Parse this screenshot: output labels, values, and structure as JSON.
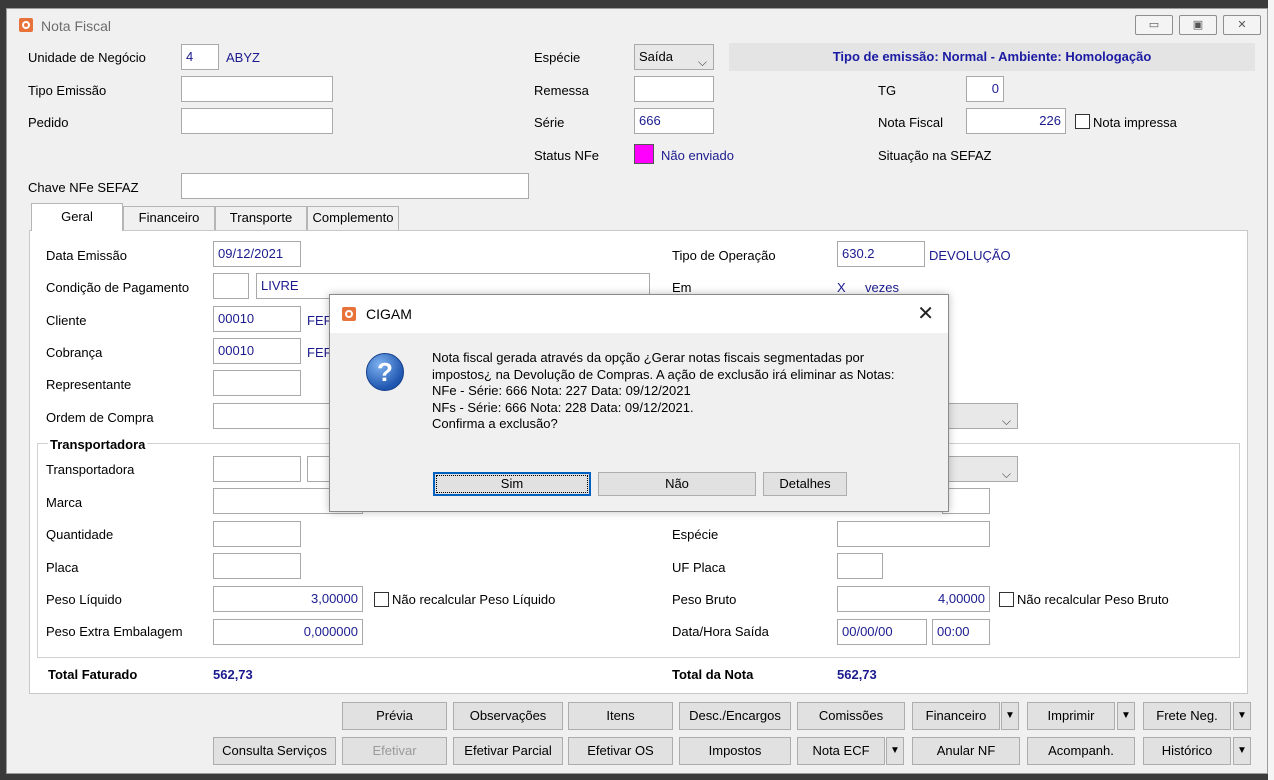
{
  "window": {
    "title": "Nota Fiscal",
    "btn_min": "▭",
    "btn_max": "▣",
    "btn_close": "✕"
  },
  "header": {
    "unidade_label": "Unidade de Negócio",
    "unidade_code": "4",
    "unidade_name": "ABYZ",
    "tipo_emissao_label": "Tipo Emissão",
    "tipo_emissao_value": "",
    "pedido_label": "Pedido",
    "pedido_value": "",
    "especie_label": "Espécie",
    "especie_value": "Saída",
    "remessa_label": "Remessa",
    "remessa_value": "",
    "serie_label": "Série",
    "serie_value": "666",
    "status_nfe_label": "Status NFe",
    "status_nfe_value": "Não enviado",
    "banner": "Tipo de emissão: Normal - Ambiente: Homologação",
    "tg_label": "TG",
    "tg_value": "0",
    "nota_fiscal_label": "Nota Fiscal",
    "nota_fiscal_value": "226",
    "nota_impressa_label": "Nota impressa",
    "situacao_label": "Situação na SEFAZ",
    "chave_label": "Chave NFe SEFAZ",
    "chave_value": ""
  },
  "tabs": [
    "Geral",
    "Financeiro",
    "Transporte",
    "Complemento"
  ],
  "geral": {
    "data_emissao_label": "Data Emissão",
    "data_emissao_value": "09/12/2021",
    "cond_pag_label": "Condição de Pagamento",
    "cond_pag_code": "",
    "cond_pag_name": "LIVRE",
    "cliente_label": "Cliente",
    "cliente_code": "00010",
    "cliente_name": "FER",
    "cobranca_label": "Cobrança",
    "cobranca_code": "00010",
    "cobranca_name": "FER",
    "representante_label": "Representante",
    "ordem_compra_label": "Ordem de Compra",
    "tipo_operacao_label": "Tipo de Operação",
    "tipo_operacao_value": "630.2",
    "tipo_operacao_name": "DEVOLUÇÃO",
    "em_label": "Em",
    "em_x": "X",
    "em_vezes": "vezes",
    "transportadora_group": "Transportadora",
    "transportadora_label": "Transportadora",
    "marca_label": "Marca",
    "quantidade_label": "Quantidade",
    "placa_label": "Placa",
    "peso_liquido_label": "Peso Líquido",
    "peso_liquido_value": "3,00000",
    "nao_recalc_liq_label": "Não recalcular Peso Líquido",
    "peso_extra_label": "Peso Extra Embalagem",
    "peso_extra_value": "0,000000",
    "especie_label": "Espécie",
    "uf_placa_label": "UF Placa",
    "peso_bruto_label": "Peso Bruto",
    "peso_bruto_value": "4,00000",
    "nao_recalc_bruto_label": "Não recalcular Peso Bruto",
    "data_hora_saida_label": "Data/Hora Saída",
    "data_saida_value": "00/00/00",
    "hora_saida_value": "00:00",
    "total_faturado_label": "Total Faturado",
    "total_faturado_value": "562,73",
    "total_nota_label": "Total da Nota",
    "total_nota_value": "562,73"
  },
  "buttons_row1": [
    "Prévia",
    "Observações",
    "Itens",
    "Desc./Encargos",
    "Comissões",
    "Financeiro",
    "Imprimir",
    "Frete Neg."
  ],
  "buttons_row2": [
    "Consulta Serviços",
    "Efetivar",
    "Efetivar Parcial",
    "Efetivar OS",
    "Impostos",
    "Nota ECF",
    "Anular NF",
    "Acompanh.",
    "Histórico"
  ],
  "dialog": {
    "title": "CIGAM",
    "lines": [
      "Nota fiscal gerada através da opção ¿Gerar notas fiscais segmentadas por",
      "impostos¿ na Devolução de Compras. A ação de exclusão irá eliminar as Notas:",
      "NFe - Série: 666   Nota: 227 Data: 09/12/2021",
      "NFs - Série: 666   Nota: 228 Data: 09/12/2021.",
      "Confirma a exclusão?"
    ],
    "btn_sim": "Sim",
    "btn_nao": "Não",
    "btn_detalhes": "Detalhes"
  },
  "colors": {
    "value_text": "#1b1b8f",
    "banner_text": "#1a1aa3",
    "status_magenta": "#ff00ff",
    "focus_blue": "#0060c0"
  }
}
